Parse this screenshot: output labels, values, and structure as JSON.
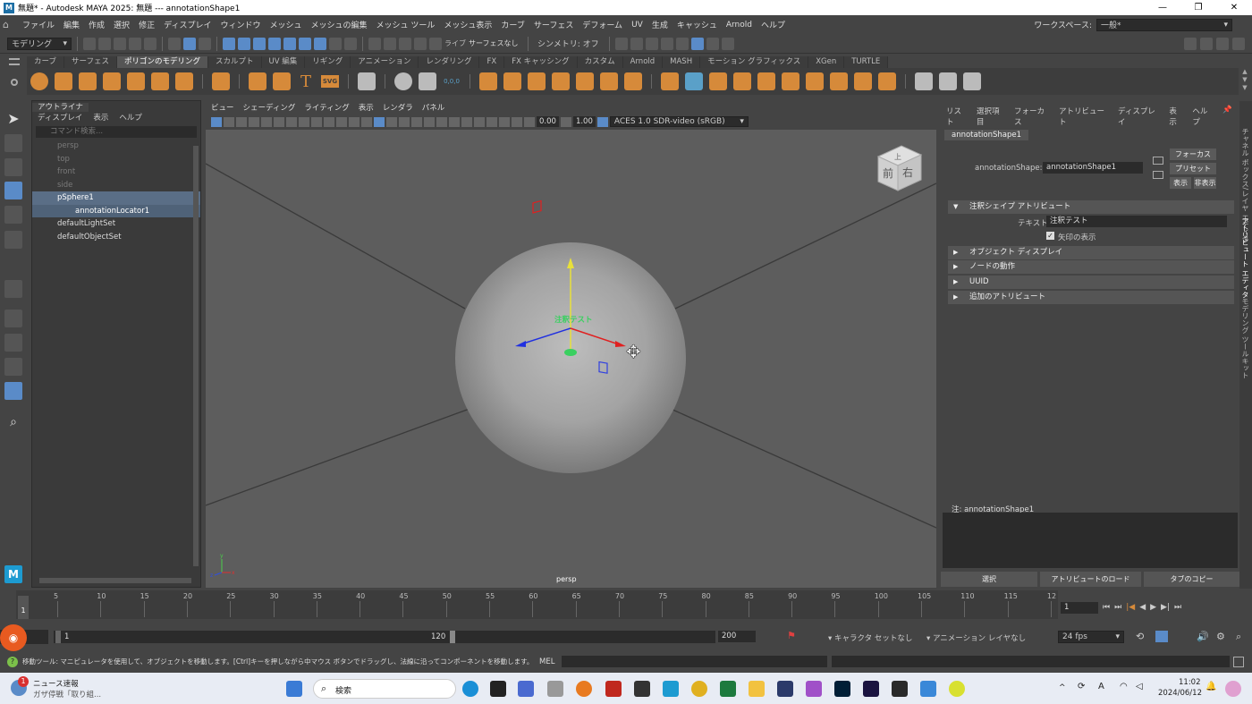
{
  "title_bar": {
    "title": "無題* - Autodesk MAYA 2025: 無題   ---   annotationShape1",
    "app_icon": "M",
    "controls": [
      "—",
      "❐",
      "✕"
    ]
  },
  "menu_bar": {
    "items": [
      "ファイル",
      "編集",
      "作成",
      "選択",
      "修正",
      "ディスプレイ",
      "ウィンドウ",
      "メッシュ",
      "メッシュの編集",
      "メッシュ ツール",
      "メッシュ表示",
      "カーブ",
      "サーフェス",
      "デフォーム",
      "UV",
      "生成",
      "キャッシュ",
      "Arnold",
      "ヘルプ"
    ],
    "workspace_label": "ワークスペース:",
    "workspace_value": "一般*"
  },
  "status_line": {
    "menuset": "モデリング",
    "live_label": "ライブ",
    "live_value": "サーフェスなし",
    "symmetry": "シンメトリ: オフ"
  },
  "shelf": {
    "tabs": [
      "カーブ",
      "サーフェス",
      "ポリゴンのモデリング",
      "スカルプト",
      "UV 編集",
      "リギング",
      "アニメーション",
      "レンダリング",
      "FX",
      "FX キャッシング",
      "カスタム",
      "Arnold",
      "MASH",
      "モーション グラフィックス",
      "XGen",
      "TURTLE"
    ],
    "active_tab": "ポリゴンのモデリング",
    "text_tool": "T",
    "svg_tool": "SVG",
    "coord_label": "0,0,0"
  },
  "outliner": {
    "tab": "アウトライナ",
    "menu": [
      "ディスプレイ",
      "表示",
      "ヘルプ"
    ],
    "search_placeholder": "コマンド検索...",
    "cameras": [
      "persp",
      "top",
      "front",
      "side"
    ],
    "sphere": "pSphere1",
    "locator": "annotationLocator1",
    "sets": [
      "defaultLightSet",
      "defaultObjectSet"
    ]
  },
  "viewport": {
    "menu": [
      "ビュー",
      "シェーディング",
      "ライティング",
      "表示",
      "レンダラ",
      "パネル"
    ],
    "exposure": "0.00",
    "gamma": "1.00",
    "color_space": "ACES 1.0 SDR-video (sRGB)",
    "camera_label": "persp",
    "annotation_text": "注釈テスト",
    "viewcube_front": "前",
    "viewcube_right": "右",
    "viewcube_top": "上",
    "axis_x": "x",
    "axis_y": "y",
    "axis_z": "z"
  },
  "attribute_editor": {
    "menu": [
      "リスト",
      "選択項目",
      "フォーカス",
      "アトリビュート",
      "ディスプレイ",
      "表示",
      "ヘルプ"
    ],
    "node_tab": "annotationShape1",
    "node_label": "annotationShape:",
    "node_value": "annotationShape1",
    "btn_focus": "フォーカス",
    "btn_preset": "プリセット",
    "btn_show": "表示",
    "btn_hide": "非表示",
    "section_annotation": "注釈シェイプ アトリビュート",
    "text_label": "テキスト",
    "text_value": "注釈テスト",
    "arrow_checkbox": "矢印の表示",
    "arrow_checked": true,
    "sections_collapsed": [
      "オブジェクト ディスプレイ",
      "ノードの動作",
      "UUID",
      "追加のアトリビュート"
    ],
    "notes_label": "注: annotationShape1",
    "bottom_buttons": [
      "選択",
      "アトリビュートのロード",
      "タブのコピー"
    ]
  },
  "side_strip": {
    "labels": [
      "チャネル ボックス/レイヤ エディタ",
      "アトリビュート エディタ",
      "モデリング ツールキット"
    ]
  },
  "time_slider": {
    "ticks": [
      "5",
      "10",
      "15",
      "20",
      "25",
      "30",
      "35",
      "40",
      "45",
      "50",
      "55",
      "60",
      "65",
      "70",
      "75",
      "80",
      "85",
      "90",
      "95",
      "100",
      "105",
      "110",
      "115",
      "12"
    ],
    "current_frame_label": "1",
    "current_frame_field": "1"
  },
  "range_slider": {
    "start": "1",
    "range_start": "1",
    "range_end": "120",
    "end": "200",
    "character_set": "キャラクタ セットなし",
    "anim_layer": "アニメーション レイヤなし",
    "fps": "24 fps"
  },
  "command_line": {
    "help_text": "移動ツール: マニピュレータを使用して、オブジェクトを移動します。[Ctrl]キーを押しながら中マウス ボタンでドラッグし、法線に沿ってコンポーネントを移動します。[Shift]キーを押しながらマニ",
    "mel_label": "MEL"
  },
  "taskbar": {
    "news_title": "ニュース速報",
    "news_sub": "ガザ停戦「取り組...",
    "news_badge": "1",
    "search_label": "検索",
    "time": "11:02",
    "date": "2024/06/12"
  },
  "colors": {
    "accent_blue": "#5a8bc8",
    "shelf_orange": "#d68a3a",
    "viewport_bg": "#5d5d5d",
    "selection": "#5a6e86"
  }
}
